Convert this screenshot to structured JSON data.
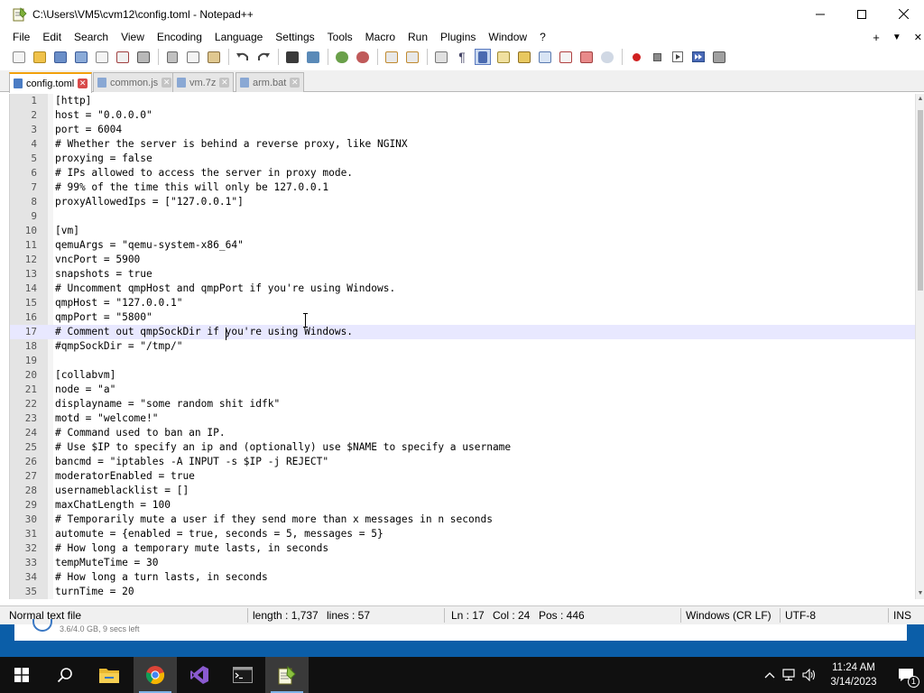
{
  "window": {
    "title": "C:\\Users\\VM5\\cvm12\\config.toml - Notepad++"
  },
  "menu": [
    "File",
    "Edit",
    "Search",
    "View",
    "Encoding",
    "Language",
    "Settings",
    "Tools",
    "Macro",
    "Run",
    "Plugins",
    "Window",
    "?"
  ],
  "menu_right": {
    "add": "+",
    "dropdown": "▼",
    "close": "✕"
  },
  "tabs": [
    {
      "label": "config.toml",
      "active": true
    },
    {
      "label": "common.js",
      "active": false
    },
    {
      "label": "vm.7z",
      "active": false
    },
    {
      "label": "arm.bat",
      "active": false
    }
  ],
  "editor": {
    "current_line": 17,
    "lines": [
      "[http]",
      "host = \"0.0.0.0\"",
      "port = 6004",
      "# Whether the server is behind a reverse proxy, like NGINX",
      "proxying = false",
      "# IPs allowed to access the server in proxy mode.",
      "# 99% of the time this will only be 127.0.0.1",
      "proxyAllowedIps = [\"127.0.0.1\"]",
      "",
      "[vm]",
      "qemuArgs = \"qemu-system-x86_64\"",
      "vncPort = 5900",
      "snapshots = true",
      "# Uncomment qmpHost and qmpPort if you're using Windows.",
      "qmpHost = \"127.0.0.1\"",
      "qmpPort = \"5800\"",
      "# Comment out qmpSockDir if you're using Windows.",
      "#qmpSockDir = \"/tmp/\"",
      "",
      "[collabvm]",
      "node = \"a\"",
      "displayname = \"some random shit idfk\"",
      "motd = \"welcome!\"",
      "# Command used to ban an IP.",
      "# Use $IP to specify an ip and (optionally) use $NAME to specify a username",
      "bancmd = \"iptables -A INPUT -s $IP -j REJECT\"",
      "moderatorEnabled = true",
      "usernameblacklist = []",
      "maxChatLength = 100",
      "# Temporarily mute a user if they send more than x messages in n seconds",
      "automute = {enabled = true, seconds = 5, messages = 5}",
      "# How long a temporary mute lasts, in seconds",
      "tempMuteTime = 30",
      "# How long a turn lasts, in seconds",
      "turnTime = 20"
    ]
  },
  "status": {
    "file_type": "Normal text file",
    "length": "length : 1,737",
    "lines": "lines : 57",
    "ln": "Ln : 17",
    "col": "Col : 24",
    "pos": "Pos : 446",
    "eol": "Windows (CR LF)",
    "encoding": "UTF-8",
    "mode": "INS"
  },
  "background_window": {
    "text": "3.6/4.0 GB, 9 secs left"
  },
  "taskbar": {
    "items": [
      "start-button",
      "search",
      "file-explorer",
      "chrome",
      "visual-studio",
      "command-prompt",
      "notepad-plus-plus"
    ],
    "clock_time": "11:24 AM",
    "clock_date": "3/14/2023",
    "notification_count": "1"
  },
  "colors": {
    "accent_tab": "#f2a10c",
    "current_line": "#e8e8ff",
    "taskbar": "#101010",
    "desktop": "#0b5ea8"
  }
}
